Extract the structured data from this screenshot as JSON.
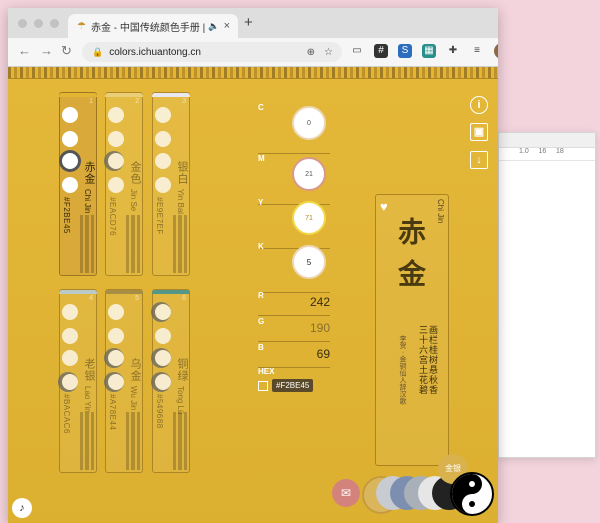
{
  "browser": {
    "tab_title": "赤金 - 中国传统颜色手册 | C",
    "url": "colors.ichuantong.cn",
    "new_tab": "+"
  },
  "bg_doc": {
    "ruler_a": "1.0",
    "ruler_b": "16",
    "ruler_c": "18"
  },
  "cards": [
    {
      "num": "1",
      "name": "赤金",
      "pinyin": "Chi Jin",
      "hex": "#F2BE45",
      "selected": true,
      "stripe": "#e3b532"
    },
    {
      "num": "2",
      "name": "金色",
      "pinyin": "Jin Se",
      "hex": "#EACD76",
      "selected": false,
      "stripe": "#eacd76"
    },
    {
      "num": "3",
      "name": "银白",
      "pinyin": "Yin Bai",
      "hex": "#E9E7EF",
      "selected": false,
      "stripe": "#e9e7ef"
    },
    {
      "num": "4",
      "name": "老银",
      "pinyin": "Lao Yin",
      "hex": "#BACAC6",
      "selected": false,
      "stripe": "#bacac6"
    },
    {
      "num": "5",
      "name": "乌金",
      "pinyin": "Wu Jin",
      "hex": "#A78E44",
      "selected": false,
      "stripe": "#a78e44"
    },
    {
      "num": "6",
      "name": "铜绿",
      "pinyin": "Tong Lü",
      "hex": "#549688",
      "selected": false,
      "stripe": "#549688"
    }
  ],
  "cmyk": [
    {
      "label": "C",
      "value": "0"
    },
    {
      "label": "M",
      "value": "21"
    },
    {
      "label": "Y",
      "value": "71"
    },
    {
      "label": "K",
      "value": "5"
    }
  ],
  "rgb": [
    {
      "label": "R",
      "value": "242"
    },
    {
      "label": "G",
      "value": "190"
    },
    {
      "label": "B",
      "value": "69"
    }
  ],
  "hex": {
    "label": "HEX",
    "value": "#F2BE45"
  },
  "detail": {
    "name": "赤金",
    "pinyin": "Chi Jin",
    "poem": "画栏桂树悬秋香 三十六宫土花碧",
    "author": "李贺 · 金铜仙人辞汉歌"
  },
  "toolbar": {
    "info": "i",
    "image": "▣",
    "download": "↓"
  },
  "palette": {
    "colors": [
      "#d9b55c",
      "#c9cbd2",
      "#7d8fb0",
      "#aab0b8",
      "#e6e6e6",
      "#222222"
    ],
    "badge": "金银"
  },
  "music_icon": "♪"
}
